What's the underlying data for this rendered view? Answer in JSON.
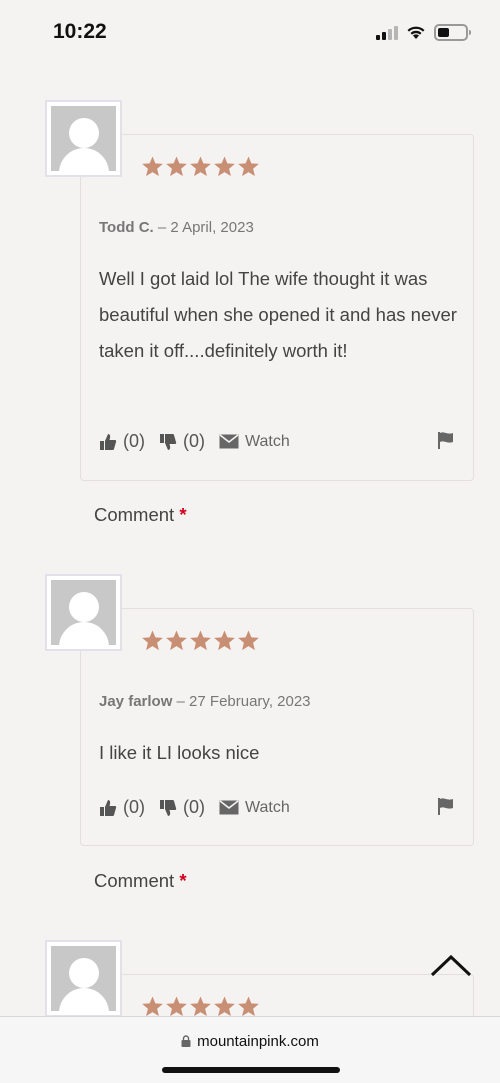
{
  "status_bar": {
    "time": "10:22"
  },
  "reviews": [
    {
      "rating": 5,
      "author": "Todd C.",
      "date": " – 2 April, 2023",
      "text": "Well I got laid lol The wife thought it was beautiful when she opened it and has never taken it off....definitely worth it!",
      "likes": "(0)",
      "dislikes": "(0)",
      "watch_label": "Watch",
      "comment_label": "Comment",
      "required_mark": "*"
    },
    {
      "rating": 5,
      "author": "Jay farlow",
      "date": " – 27 February, 2023",
      "text": "I like it LI looks nice",
      "likes": "(0)",
      "dislikes": "(0)",
      "watch_label": "Watch",
      "comment_label": "Comment",
      "required_mark": "*"
    },
    {
      "rating": 5
    }
  ],
  "browser": {
    "url": "mountainpink.com"
  },
  "colors": {
    "star": "#c98f74",
    "background": "#f5f3f2",
    "required": "#d0021b"
  }
}
